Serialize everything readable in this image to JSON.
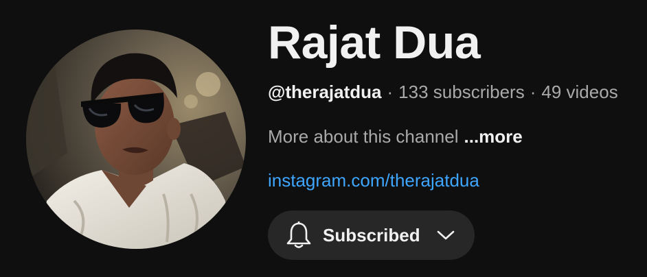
{
  "channel": {
    "name": "Rajat Dua",
    "handle": "@therajatdua",
    "separator": "·",
    "subscribers": "133 subscribers",
    "videos": "49 videos",
    "description": "More about this channel",
    "more_label": "...more",
    "link": "instagram.com/therajatdua",
    "avatar_icon": "channel-avatar-photo"
  },
  "subscribe_button": {
    "label": "Subscribed",
    "icon_left": "bell-icon",
    "icon_right": "chevron-down-icon"
  },
  "colors": {
    "background": "#0f0f0f",
    "text_primary": "#f1f1f1",
    "text_secondary": "#aaaaaa",
    "link": "#3ea6ff",
    "button_bg": "#272727"
  }
}
